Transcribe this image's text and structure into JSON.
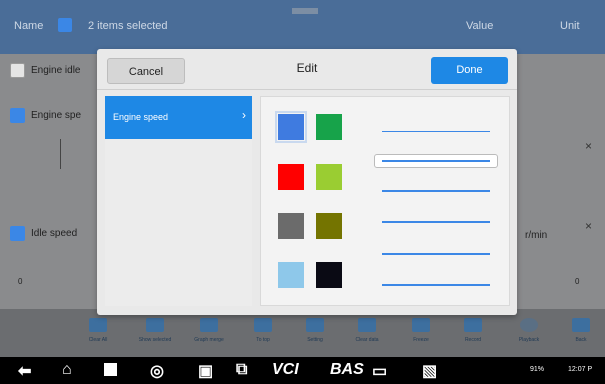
{
  "background": {
    "header": {
      "name": "Name",
      "selected": "2 items selected",
      "value": "Value",
      "unit": "Unit"
    },
    "rows": [
      {
        "label": "Engine idle",
        "checked": false
      },
      {
        "label": "Engine spe",
        "checked": true
      },
      {
        "label": "Idle speed",
        "checked": true
      }
    ],
    "unit_right": "r/min",
    "tick_left": "0",
    "tick_right": "0",
    "toolbar": [
      "Clear All",
      "Show selected",
      "Graph merge",
      "To top",
      "Setting",
      "Clear data",
      "Freeze",
      "Record",
      "Playback",
      "Back"
    ]
  },
  "modal": {
    "cancel_label": "Cancel",
    "title": "Edit",
    "done_label": "Done",
    "list": [
      {
        "label": "Engine speed",
        "chevron": "chevron-right-icon",
        "selected": true
      }
    ],
    "colors": [
      "#3f7be0",
      "#17a34a",
      "#ff0000",
      "#9acd32",
      "#6b6b6b",
      "#747400",
      "#8ec8ea",
      "#0a0a14"
    ],
    "selected_color_index": 0,
    "line_styles": [
      "thin",
      "thick-selected",
      "medium",
      "medium",
      "medium",
      "medium"
    ],
    "selected_line_index": 1
  },
  "systembar": {
    "icons": [
      "back-icon",
      "home-icon",
      "recents-icon",
      "vpn-icon",
      "camera-icon",
      "screen-mirror-icon",
      "vci-icon",
      "bas-icon",
      "car-icon",
      "user-car-icon"
    ],
    "vci_label": "VCI",
    "bas_label": "BAS",
    "status": "91%",
    "time": "12:07 P"
  }
}
